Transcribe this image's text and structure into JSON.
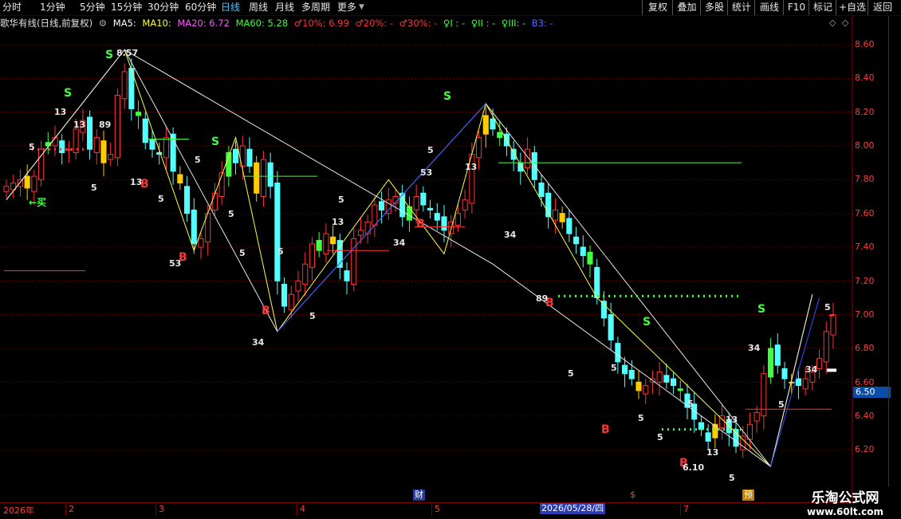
{
  "toolbar": {
    "periods": [
      "分时",
      "1分钟",
      "5分钟",
      "15分钟",
      "30分钟",
      "60分钟",
      "日线",
      "周线",
      "月线",
      "多周期",
      "更多"
    ],
    "active_period": "日线",
    "buttons": [
      "复权",
      "叠加",
      "多股",
      "统计",
      "画线",
      "F10",
      "标记",
      "+自选",
      "返回"
    ]
  },
  "info": {
    "title": "歌华有线(日线,前复权)",
    "ma5": "MA5:",
    "ma10": "MA10:",
    "ma20": "MA20: 6.72",
    "ma60": "MA60: 5.28",
    "p10": "♂10%: 6.99",
    "p20": "♂20%: -",
    "p30": "♂30%: -",
    "c1": "♀I : -",
    "c2": "♀II : -",
    "c3": "♀III: -",
    "b3": "B3: -"
  },
  "colors": {
    "up": "#ff3333",
    "down": "#54ffff",
    "grid": "#7a0000",
    "ma_white": "#ffffff",
    "ma_yellow": "#ffff40"
  },
  "y_axis": {
    "labels": [
      "8.60",
      "8.40",
      "8.20",
      "8.00",
      "7.80",
      "7.60",
      "7.40",
      "7.20",
      "7.00",
      "6.80",
      "6.60",
      "6.40",
      "6.20"
    ]
  },
  "current_price": "6.50",
  "x_axis": {
    "labels": [
      "2026年",
      "2",
      "3",
      "4",
      "5",
      "7"
    ],
    "cursor_date": "2026/05/28/四"
  },
  "events": [
    "财",
    "$",
    "预"
  ],
  "annotations": {
    "high_label": "8.57",
    "low_label": "6.10",
    "buy_text": "←买",
    "signals_s": [
      "S",
      "S",
      "S",
      "S",
      "S",
      "S"
    ],
    "signals_b": [
      "B",
      "B",
      "B",
      "B",
      "B",
      "B",
      "B"
    ],
    "numbers": [
      "13",
      "5",
      "5",
      "13",
      "5",
      "5",
      "53",
      "5",
      "34",
      "5",
      "13",
      "5",
      "53",
      "13",
      "5",
      "34",
      "89",
      "5",
      "5",
      "5",
      "5",
      "5",
      "13",
      "34",
      "13",
      "5",
      "5",
      "34",
      "5",
      "89",
      "13",
      "5",
      "5",
      "34"
    ]
  },
  "watermark": {
    "line1": "乐淘公式网",
    "line2": "www.60lt.com"
  },
  "chart_data": {
    "type": "candlestick",
    "ylim": [
      6.1,
      8.7
    ],
    "ohlc_close_series": [
      7.76,
      7.78,
      7.8,
      7.75,
      7.82,
      7.98,
      8.02,
      8.05,
      7.96,
      7.98,
      8.1,
      8.15,
      7.98,
      8.05,
      7.9,
      7.95,
      8.3,
      8.44,
      8.22,
      8.18,
      8.02,
      7.98,
      7.95,
      8.05,
      7.85,
      7.78,
      7.6,
      7.42,
      7.45,
      7.6,
      7.72,
      7.84,
      7.96,
      7.9,
      8.0,
      7.88,
      7.72,
      7.92,
      7.76,
      7.2,
      7.05,
      7.12,
      7.2,
      7.3,
      7.42,
      7.38,
      7.48,
      7.42,
      7.28,
      7.2,
      7.45,
      7.5,
      7.55,
      7.65,
      7.62,
      7.68,
      7.7,
      7.58,
      7.64,
      7.7,
      7.65,
      7.62,
      7.56,
      7.5,
      7.55,
      7.6,
      7.68,
      7.95,
      8.05,
      8.18,
      8.1,
      8.05,
      8.0,
      7.92,
      7.85,
      7.98,
      7.8,
      7.7,
      7.58,
      7.62,
      7.55,
      7.48,
      7.42,
      7.35,
      7.3,
      7.1,
      6.98,
      6.85,
      6.72,
      6.65,
      6.62,
      6.55,
      6.58,
      6.62,
      6.66,
      6.6,
      6.58,
      6.55,
      6.45,
      6.38,
      6.32,
      6.25,
      6.35,
      6.4,
      6.3,
      6.22,
      6.28,
      6.35,
      6.42,
      6.65,
      6.8,
      6.7,
      6.62,
      6.6,
      6.58,
      6.62,
      6.66,
      6.74,
      6.9,
      7.0
    ]
  }
}
